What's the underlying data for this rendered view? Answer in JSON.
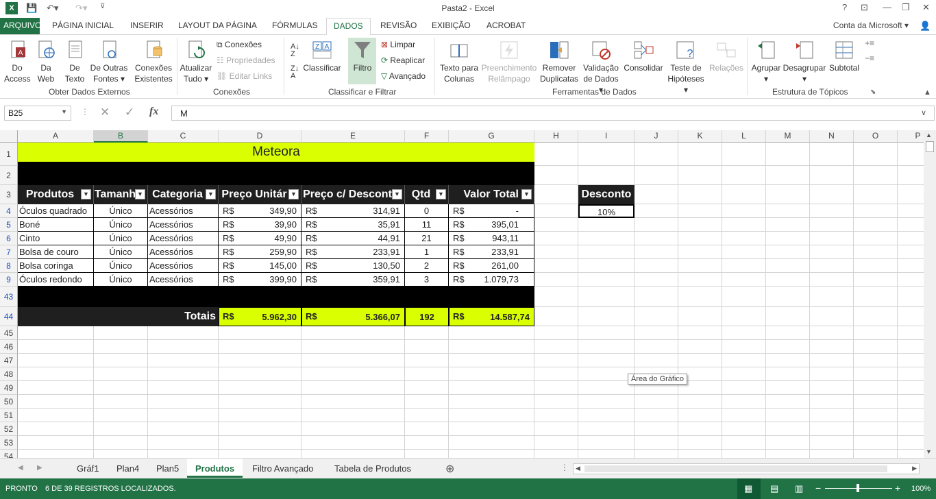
{
  "window": {
    "title": "Pasta2 - Excel",
    "account": "Conta da Microsoft"
  },
  "ribbon_tabs": [
    "ARQUIVO",
    "PÁGINA INICIAL",
    "INSERIR",
    "LAYOUT DA PÁGINA",
    "FÓRMULAS",
    "DADOS",
    "REVISÃO",
    "EXIBIÇÃO",
    "ACROBAT"
  ],
  "active_tab": "DADOS",
  "ribbon": {
    "do_access": [
      "Do",
      "Access"
    ],
    "da_web": [
      "Da",
      "Web"
    ],
    "de_texto": [
      "De",
      "Texto"
    ],
    "de_outras": [
      "De Outras",
      "Fontes ▾"
    ],
    "conexoes_existentes": [
      "Conexões",
      "Existentes"
    ],
    "atualizar": [
      "Atualizar",
      "Tudo ▾"
    ],
    "conexoes": "Conexões",
    "propriedades": "Propriedades",
    "editar_links": "Editar Links",
    "classificar": "Classificar",
    "filtro": "Filtro",
    "limpar": "Limpar",
    "reaplicar": "Reaplicar",
    "avancado": "Avançado",
    "texto_colunas": [
      "Texto para",
      "Colunas"
    ],
    "preenchimento": [
      "Preenchimento",
      "Relâmpago"
    ],
    "remover": [
      "Remover",
      "Duplicatas"
    ],
    "validacao": [
      "Validação",
      "de Dados ▾"
    ],
    "consolidar": "Consolidar",
    "teste": [
      "Teste de",
      "Hipóteses ▾"
    ],
    "relacoes": "Relações",
    "agrupar": "Agrupar",
    "desagrupar": "Desagrupar",
    "subtotal": "Subtotal",
    "groups": {
      "obter": "Obter Dados Externos",
      "conexoes": "Conexões",
      "classificar": "Classificar e Filtrar",
      "ferramentas": "Ferramentas de Dados",
      "estrutura": "Estrutura de Tópicos"
    }
  },
  "formula_bar": {
    "name_box": "B25",
    "formula": "M"
  },
  "columns": [
    "A",
    "B",
    "C",
    "D",
    "E",
    "F",
    "G",
    "H",
    "I",
    "J",
    "K",
    "L",
    "M",
    "N",
    "O",
    "P"
  ],
  "selected_column": "B",
  "rows": [
    "1",
    "2",
    "3",
    "4",
    "5",
    "6",
    "7",
    "8",
    "9",
    "43",
    "44",
    "45",
    "46",
    "47",
    "48",
    "49",
    "50",
    "51",
    "52",
    "53",
    "54"
  ],
  "sheet": {
    "title": "Meteora",
    "headers": [
      "Produtos",
      "Tamanh",
      "Categoria",
      "Preço Unitár",
      "Preço c/ Descont",
      "Qtd",
      "Valor Total"
    ],
    "currency": "R$",
    "data": [
      {
        "produto": "Óculos quadrado",
        "tamanho": "Único",
        "categoria": "Acessórios",
        "preco": "349,90",
        "preco_desc": "314,91",
        "qtd": "0",
        "valor": "-"
      },
      {
        "produto": "Boné",
        "tamanho": "Único",
        "categoria": "Acessórios",
        "preco": "39,90",
        "preco_desc": "35,91",
        "qtd": "11",
        "valor": "395,01"
      },
      {
        "produto": "Cinto",
        "tamanho": "Único",
        "categoria": "Acessórios",
        "preco": "49,90",
        "preco_desc": "44,91",
        "qtd": "21",
        "valor": "943,11"
      },
      {
        "produto": "Bolsa de couro",
        "tamanho": "Único",
        "categoria": "Acessórios",
        "preco": "259,90",
        "preco_desc": "233,91",
        "qtd": "1",
        "valor": "233,91"
      },
      {
        "produto": "Bolsa coringa",
        "tamanho": "Único",
        "categoria": "Acessórios",
        "preco": "145,00",
        "preco_desc": "130,50",
        "qtd": "2",
        "valor": "261,00"
      },
      {
        "produto": "Óculos redondo",
        "tamanho": "Único",
        "categoria": "Acessórios",
        "preco": "399,90",
        "preco_desc": "359,91",
        "qtd": "3",
        "valor": "1.079,73"
      }
    ],
    "totals": {
      "label": "Totais",
      "preco": "5.962,30",
      "preco_desc": "5.366,07",
      "qtd": "192",
      "valor": "14.587,74"
    },
    "desconto": {
      "label": "Desconto",
      "value": "10%"
    }
  },
  "tooltip": "Área do Gráfico",
  "sheet_tabs": [
    "Gráf1",
    "Plan4",
    "Plan5",
    "Produtos",
    "Filtro Avançado",
    "Tabela de Produtos"
  ],
  "active_sheet": "Produtos",
  "status": {
    "mode": "PRONTO",
    "message": "6 DE 39 REGISTROS LOCALIZADOS.",
    "zoom": "100%"
  },
  "colors": {
    "excel_green": "#217346",
    "highlight": "#d9ff00",
    "header_dark": "#1f1f1f"
  }
}
